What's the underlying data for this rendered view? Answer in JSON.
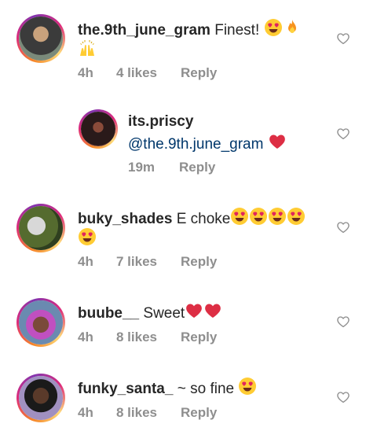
{
  "comments": [
    {
      "username": "the.9th_june_gram",
      "text": "Finest!",
      "emojis": [
        "heart-eyes-emoji",
        "fire-emoji",
        "raising-hands-emoji"
      ],
      "time": "4h",
      "likes": "4 likes",
      "reply": "Reply"
    },
    {
      "username": "its.priscy",
      "mention": "@the.9th.june_gram",
      "emojis": [
        "red-heart-emoji"
      ],
      "time": "19m",
      "reply": "Reply"
    },
    {
      "username": "buky_shades",
      "text": "E choke",
      "emojis": [
        "heart-eyes-emoji",
        "heart-eyes-emoji",
        "heart-eyes-emoji",
        "heart-eyes-emoji",
        "heart-eyes-emoji"
      ],
      "time": "4h",
      "likes": "7 likes",
      "reply": "Reply"
    },
    {
      "username": "buube__",
      "text": "Sweet",
      "emojis": [
        "red-heart-emoji",
        "red-heart-emoji"
      ],
      "time": "4h",
      "likes": "8 likes",
      "reply": "Reply"
    },
    {
      "username": "funky_santa_",
      "text": "~ so fine",
      "emojis": [
        "heart-eyes-emoji"
      ],
      "time": "4h",
      "likes": "8 likes",
      "reply": "Reply"
    }
  ],
  "colors": {
    "username": "#262626",
    "mention": "#00376b",
    "meta": "#8e8e8e",
    "heart": "#e0245e"
  }
}
